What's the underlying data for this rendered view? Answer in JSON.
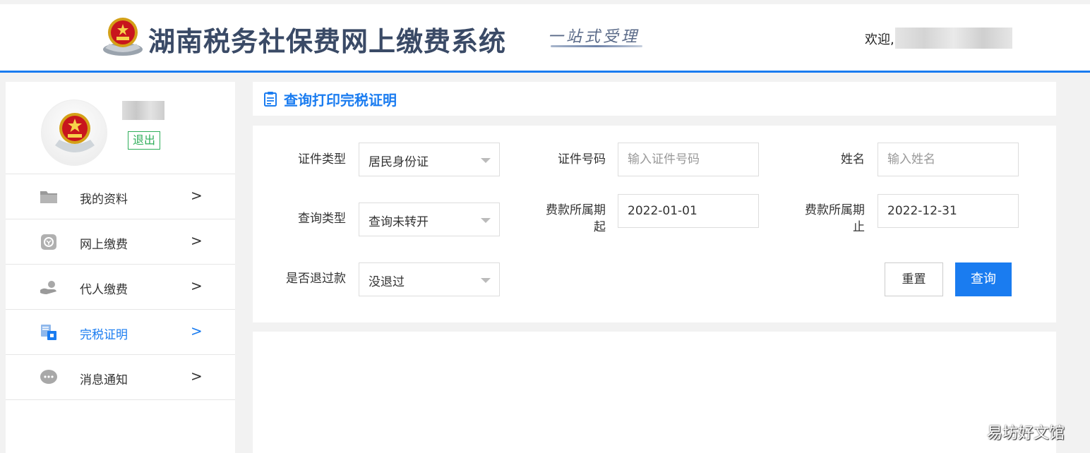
{
  "header": {
    "title": "湖南税务社保费网上缴费系统",
    "slogan": "一站式受理",
    "welcome": "欢迎,"
  },
  "sidebar": {
    "logout_label": "退出",
    "items": [
      {
        "label": "我的资料",
        "icon": "folder-icon"
      },
      {
        "label": "网上缴费",
        "icon": "payment-icon"
      },
      {
        "label": "代人缴费",
        "icon": "hand-coin-icon"
      },
      {
        "label": "完税证明",
        "icon": "certificate-icon",
        "active": true
      },
      {
        "label": "消息通知",
        "icon": "message-icon"
      }
    ],
    "chevron": ">"
  },
  "main": {
    "title": "查询打印完税证明",
    "form": {
      "id_type_label": "证件类型",
      "id_type_value": "居民身份证",
      "id_number_label": "证件号码",
      "id_number_placeholder": "输入证件号码",
      "name_label": "姓名",
      "name_placeholder": "输入姓名",
      "query_type_label": "查询类型",
      "query_type_value": "查询未转开",
      "period_start_label": "费款所属期起",
      "period_start_value": "2022-01-01",
      "period_end_label": "费款所属期止",
      "period_end_value": "2022-12-31",
      "refund_label": "是否退过款",
      "refund_value": "没退过",
      "reset_label": "重置",
      "query_label": "查询"
    }
  },
  "watermark": "易坊好文馆",
  "colors": {
    "accent": "#1a7cf0",
    "logout_green": "#2fae5a"
  }
}
